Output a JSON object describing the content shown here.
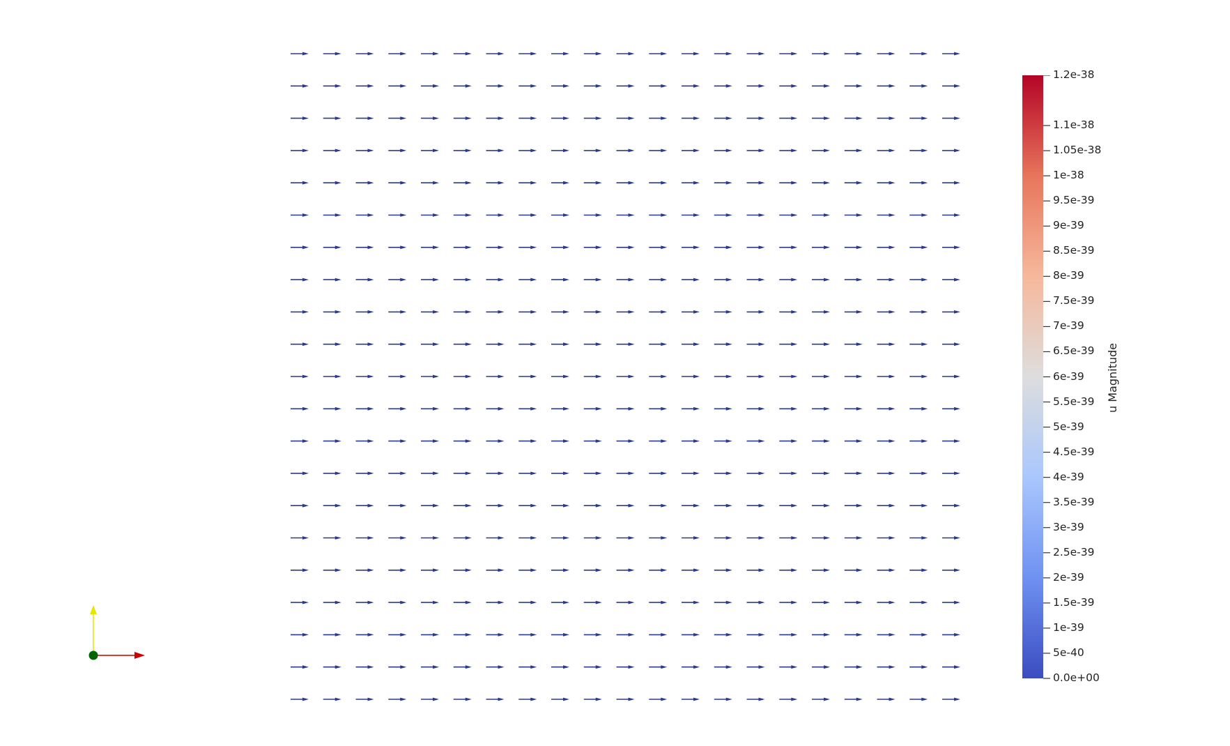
{
  "scalar_bar": {
    "title": "u Magnitude",
    "colormap": [
      "#3b4cc0",
      "#6f91f2",
      "#aac7fd",
      "#dddddd",
      "#f6b89c",
      "#e7755b",
      "#b40426"
    ],
    "labels": [
      "1.2e-38",
      "1.1e-38",
      "1.05e-38",
      "1e-38",
      "9.5e-39",
      "9e-39",
      "8.5e-39",
      "8e-39",
      "7.5e-39",
      "7e-39",
      "6.5e-39",
      "6e-39",
      "5.5e-39",
      "5e-39",
      "4.5e-39",
      "4e-39",
      "3.5e-39",
      "3e-39",
      "2.5e-39",
      "2e-39",
      "1.5e-39",
      "1e-39",
      "5e-40",
      "0.0e+00"
    ],
    "values": [
      1.2e-38,
      1.1e-38,
      1.05e-38,
      1e-38,
      9.5e-39,
      9e-39,
      8.5e-39,
      8e-39,
      7.5e-39,
      7e-39,
      6.5e-39,
      6e-39,
      5.5e-39,
      5e-39,
      4.5e-39,
      4e-39,
      3.5e-39,
      3e-39,
      2.5e-39,
      2e-39,
      1.5e-39,
      1e-39,
      5e-40,
      0.0
    ],
    "range": [
      0,
      1.2e-38
    ]
  },
  "glyph_field": {
    "columns": 21,
    "rows": 21,
    "direction": "+x",
    "color": "#2b3a8c"
  },
  "orientation_axes": {
    "x_color": "#cc0000",
    "y_color": "#e6e600",
    "z_color": "#006400"
  }
}
